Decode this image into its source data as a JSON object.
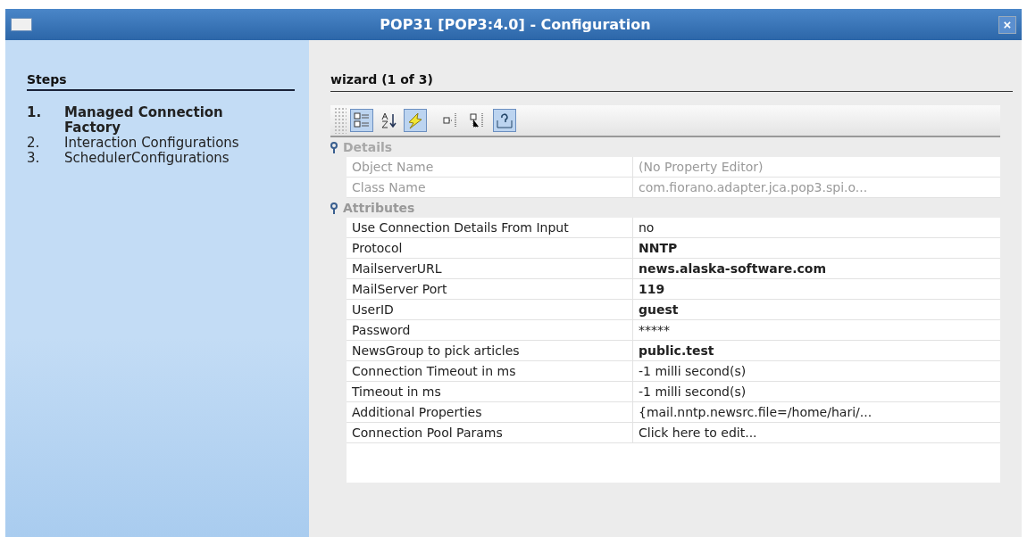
{
  "window": {
    "title": "POP31 [POP3:4.0] - Configuration",
    "close": "×"
  },
  "steps": {
    "heading": "Steps",
    "items": [
      {
        "number": "1.",
        "label": "Managed Connection Factory",
        "selected": true
      },
      {
        "number": "2.",
        "label": "Interaction Configurations",
        "selected": false
      },
      {
        "number": "3.",
        "label": "SchedulerConfigurations",
        "selected": false
      }
    ]
  },
  "wizard": {
    "heading": "wizard (1 of 3)"
  },
  "toolbar": [
    {
      "kind": "categorized",
      "pressed": true
    },
    {
      "kind": "sort",
      "pressed": false
    },
    {
      "kind": "lightning",
      "pressed": true
    },
    {
      "kind": "expand",
      "pressed": false
    },
    {
      "kind": "collapse",
      "pressed": false
    },
    {
      "kind": "help",
      "pressed": true
    }
  ],
  "sections": [
    {
      "name": "Details",
      "disabled": true,
      "rows": [
        {
          "name": "Object Name",
          "value": "(No Property Editor)",
          "modified": false
        },
        {
          "name": "Class Name",
          "value": "com.fiorano.adapter.jca.pop3.spi.o...",
          "modified": false
        }
      ]
    },
    {
      "name": "Attributes",
      "disabled": false,
      "rows": [
        {
          "name": "Use Connection Details From Input",
          "value": "no",
          "modified": false
        },
        {
          "name": "Protocol",
          "value": "NNTP",
          "modified": true
        },
        {
          "name": "MailserverURL",
          "value": "news.alaska-software.com",
          "modified": true
        },
        {
          "name": "MailServer Port",
          "value": "119",
          "modified": true
        },
        {
          "name": "UserID",
          "value": "guest",
          "modified": true
        },
        {
          "name": "Password",
          "value": "*****",
          "modified": false
        },
        {
          "name": "NewsGroup to pick articles",
          "value": "public.test",
          "modified": true
        },
        {
          "name": "Connection Timeout in ms",
          "value": "-1 milli second(s)",
          "modified": false
        },
        {
          "name": "Timeout in ms",
          "value": "-1 milli second(s)",
          "modified": false
        },
        {
          "name": "Additional Properties",
          "value": "{mail.nntp.newsrc.file=/home/hari/...",
          "modified": false
        },
        {
          "name": "Connection Pool Params",
          "value": "Click here to edit...",
          "modified": false
        }
      ]
    }
  ]
}
